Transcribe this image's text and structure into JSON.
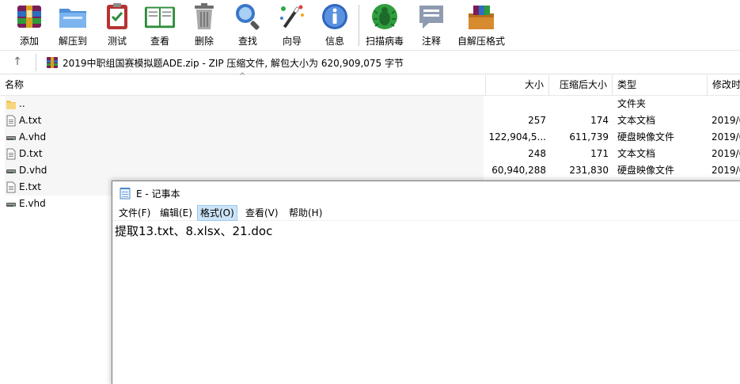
{
  "toolbar": {
    "buttons": [
      {
        "label": "添加",
        "icon": "add-icon"
      },
      {
        "label": "解压到",
        "icon": "extract-to-icon"
      },
      {
        "label": "测试",
        "icon": "test-icon"
      },
      {
        "label": "查看",
        "icon": "view-icon"
      },
      {
        "label": "删除",
        "icon": "delete-icon"
      },
      {
        "label": "查找",
        "icon": "find-icon"
      },
      {
        "label": "向导",
        "icon": "wizard-icon"
      },
      {
        "label": "信息",
        "icon": "info-icon"
      },
      {
        "label": "扫描病毒",
        "icon": "virus-scan-icon"
      },
      {
        "label": "注释",
        "icon": "comment-icon"
      },
      {
        "label": "自解压格式",
        "icon": "sfx-icon"
      }
    ]
  },
  "pathbar": {
    "up": "↑",
    "path": "2019中职组国赛模拟题ADE.zip - ZIP 压缩文件, 解包大小为 620,909,075 字节"
  },
  "columns": {
    "name": "名称",
    "size": "大小",
    "packed": "压缩后大小",
    "type": "类型",
    "modified": "修改时"
  },
  "files": [
    {
      "name": "..",
      "size": "",
      "packed": "",
      "type": "文件夹",
      "modified": "",
      "icon": "folder-icon"
    },
    {
      "name": "A.txt",
      "size": "257",
      "packed": "174",
      "type": "文本文档",
      "modified": "2019/0",
      "icon": "text-file-icon"
    },
    {
      "name": "A.vhd",
      "size": "122,904,5...",
      "packed": "611,739",
      "type": "硬盘映像文件",
      "modified": "2019/0",
      "icon": "disk-image-icon"
    },
    {
      "name": "D.txt",
      "size": "248",
      "packed": "171",
      "type": "文本文档",
      "modified": "2019/0",
      "icon": "text-file-icon"
    },
    {
      "name": "D.vhd",
      "size": "60,940,288",
      "packed": "231,830",
      "type": "硬盘映像文件",
      "modified": "2019/0",
      "icon": "disk-image-icon"
    },
    {
      "name": "E.txt",
      "size": "",
      "packed": "",
      "type": "",
      "modified": "",
      "icon": "text-file-icon"
    },
    {
      "name": "E.vhd",
      "size": "",
      "packed": "",
      "type": "",
      "modified": "",
      "icon": "disk-image-icon"
    }
  ],
  "notepad": {
    "title": "E - 记事本",
    "menu": [
      "文件(F)",
      "编辑(E)",
      "格式(O)",
      "查看(V)",
      "帮助(H)"
    ],
    "active_menu": "格式(O)",
    "content": "提取13.txt、8.xlsx、21.doc"
  }
}
